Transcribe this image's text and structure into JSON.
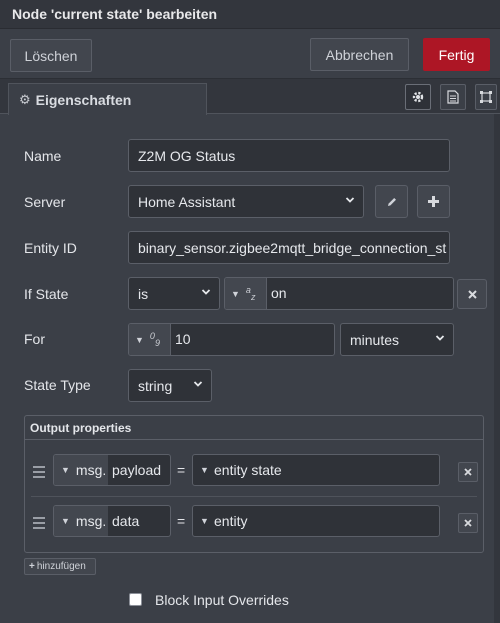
{
  "dialog": {
    "title": "Node 'current state' bearbeiten"
  },
  "toolbar": {
    "delete_label": "Löschen",
    "cancel_label": "Abbrechen",
    "done_label": "Fertig"
  },
  "tabs": {
    "properties_label": "Eigenschaften"
  },
  "form": {
    "name": {
      "label": "Name",
      "value": "Z2M OG Status"
    },
    "server": {
      "label": "Server",
      "value": "Home Assistant"
    },
    "entity_id": {
      "label": "Entity ID",
      "value": "binary_sensor.zigbee2mqtt_bridge_connection_st"
    },
    "if_state": {
      "label": "If State",
      "operator": "is",
      "type_glyph": "a z",
      "value": "on"
    },
    "for": {
      "label": "For",
      "type_glyph": "0 9",
      "value": "10",
      "unit": "minutes"
    },
    "state_type": {
      "label": "State Type",
      "value": "string"
    }
  },
  "output": {
    "header": "Output properties",
    "rows": [
      {
        "prefix": "msg.",
        "property": "payload",
        "equals": "=",
        "value": "entity state"
      },
      {
        "prefix": "msg.",
        "property": "data",
        "equals": "=",
        "value": "entity"
      }
    ],
    "add_label": "hinzufügen"
  },
  "block_input_overrides": {
    "label": "Block Input Overrides",
    "checked": false
  },
  "colors": {
    "accent": "#ad1625",
    "background": "#3b3f47",
    "field": "#2f3238"
  }
}
